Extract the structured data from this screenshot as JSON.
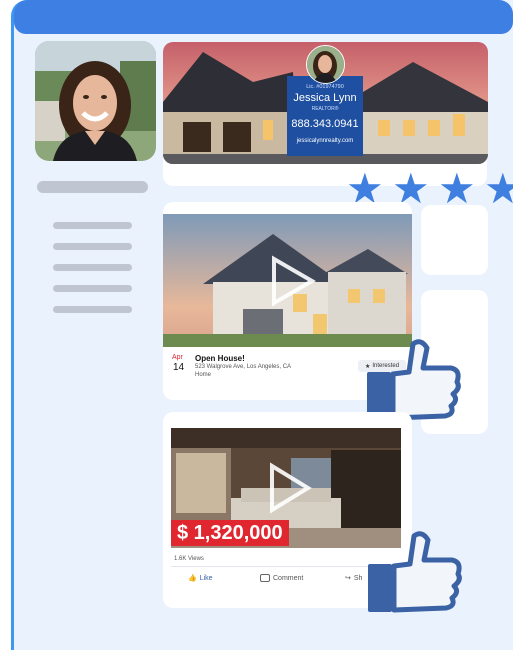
{
  "agent": {
    "license": "Lic. #01974790",
    "name": "Jessica Lynn",
    "title": "REALTOR®",
    "phone": "888.343.0941",
    "website": "jessicalynnrealty.com"
  },
  "rating": {
    "stars": 4
  },
  "event_post": {
    "month": "Apr",
    "day": "14",
    "title": "Open House!",
    "address": "523 Walgrove Ave, Los Angeles, CA",
    "type": "Home",
    "interested_label": "Interested"
  },
  "video_post": {
    "price": "$ 1,320,000",
    "views": "1.6K Views",
    "like_label": "Like",
    "comment_label": "Comment",
    "share_label": "Sh"
  },
  "colors": {
    "accent": "#3d7fe3",
    "price_badge": "#e0262f",
    "thumbs": "#3b62a4"
  }
}
